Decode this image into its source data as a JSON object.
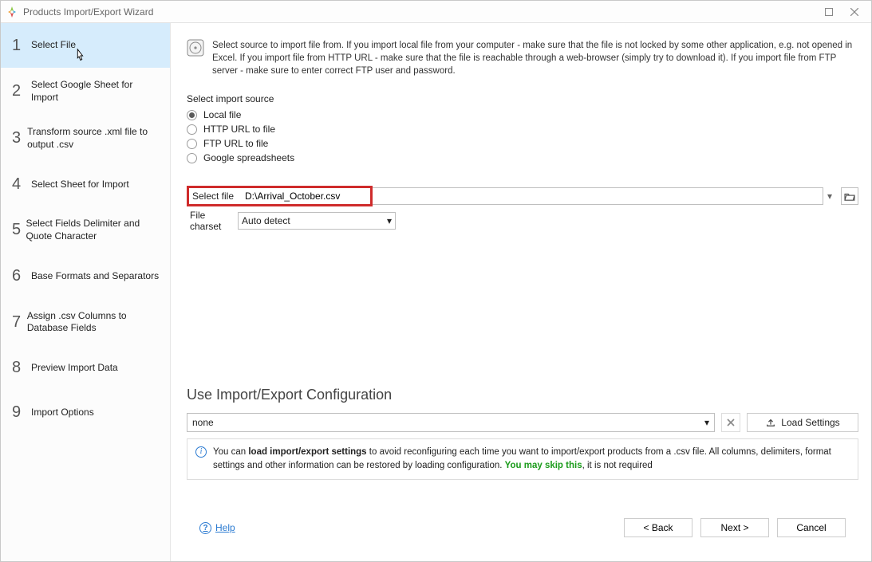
{
  "window": {
    "title": "Products Import/Export Wizard"
  },
  "steps": [
    {
      "num": "1",
      "label": "Select File"
    },
    {
      "num": "2",
      "label": "Select Google Sheet for Import"
    },
    {
      "num": "3",
      "label": "Transform source .xml file to output .csv"
    },
    {
      "num": "4",
      "label": "Select Sheet for Import"
    },
    {
      "num": "5",
      "label": "Select Fields Delimiter and Quote Character"
    },
    {
      "num": "6",
      "label": "Base Formats and Separators"
    },
    {
      "num": "7",
      "label": "Assign .csv Columns to Database Fields"
    },
    {
      "num": "8",
      "label": "Preview Import Data"
    },
    {
      "num": "9",
      "label": "Import Options"
    }
  ],
  "info": {
    "text": "Select source to import file from. If you import local file from your computer - make sure that the file is not locked by some other application, e.g. not opened in Excel. If you import file from HTTP URL - make sure that the file is reachable through a web-browser (simply try to download it). If you import file from FTP server - make sure to enter correct FTP user and password."
  },
  "source": {
    "label": "Select import source",
    "options": [
      {
        "label": "Local file",
        "checked": true
      },
      {
        "label": "HTTP URL to file",
        "checked": false
      },
      {
        "label": "FTP URL to file",
        "checked": false
      },
      {
        "label": "Google spreadsheets",
        "checked": false
      }
    ]
  },
  "fields": {
    "selectFileLabel": "Select file",
    "filePath": "D:\\Arrival_October.csv",
    "charsetLabel": "File charset",
    "charsetValue": "Auto detect"
  },
  "config": {
    "title": "Use Import/Export Configuration",
    "selectValue": "none",
    "loadLabel": "Load Settings",
    "infoPrefix": "You can ",
    "infoBold": "load import/export settings",
    "infoMid": " to avoid reconfiguring each time you want to import/export products from a .csv file. All columns, delimiters, format settings and other information can be restored by loading configuration. ",
    "infoSkip": "You may skip this",
    "infoEnd": ", it is not required"
  },
  "footer": {
    "help": "Help",
    "back": "< Back",
    "next": "Next >",
    "cancel": "Cancel"
  }
}
